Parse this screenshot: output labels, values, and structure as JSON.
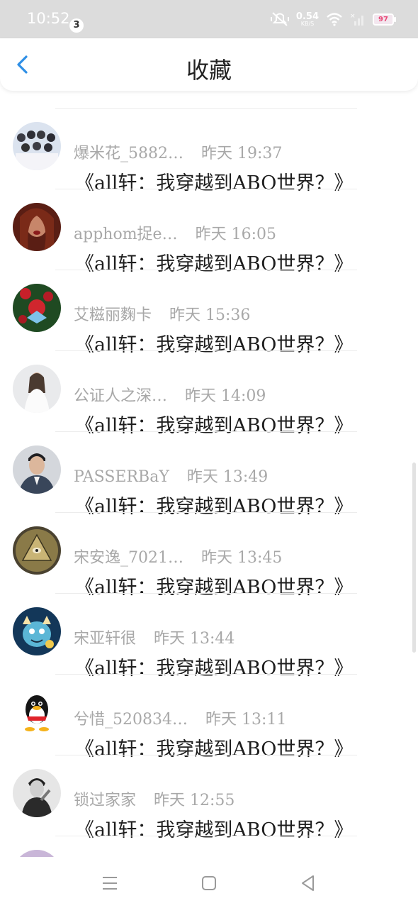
{
  "status": {
    "time": "10:52",
    "notif_count": "3",
    "net_speed": "0.54",
    "net_unit": "KB/S",
    "battery": "97"
  },
  "header": {
    "title": "收藏"
  },
  "items": [
    {
      "name": "爆米花_5882…",
      "time": "昨天 19:37",
      "title": "《all轩：我穿越到ABO世界？》"
    },
    {
      "name": "apphom捉e…",
      "time": "昨天 16:05",
      "title": "《all轩：我穿越到ABO世界？》"
    },
    {
      "name": "艾糍丽麴卡",
      "time": "昨天 15:36",
      "title": "《all轩：我穿越到ABO世界？》"
    },
    {
      "name": "公证人之深…",
      "time": "昨天 14:09",
      "title": "《all轩：我穿越到ABO世界？》"
    },
    {
      "name": "PASSERBaY",
      "time": "昨天 13:49",
      "title": "《all轩：我穿越到ABO世界？》"
    },
    {
      "name": "宋安逸_7021…",
      "time": "昨天 13:45",
      "title": "《all轩：我穿越到ABO世界？》"
    },
    {
      "name": "宋亚轩很",
      "time": "昨天 13:44",
      "title": "《all轩：我穿越到ABO世界？》"
    },
    {
      "name": "兮惜_520834…",
      "time": "昨天 13:11",
      "title": "《all轩：我穿越到ABO世界？》"
    },
    {
      "name": "锁过家家",
      "time": "昨天 12:55",
      "title": "《all轩：我穿越到ABO世界？》"
    }
  ]
}
